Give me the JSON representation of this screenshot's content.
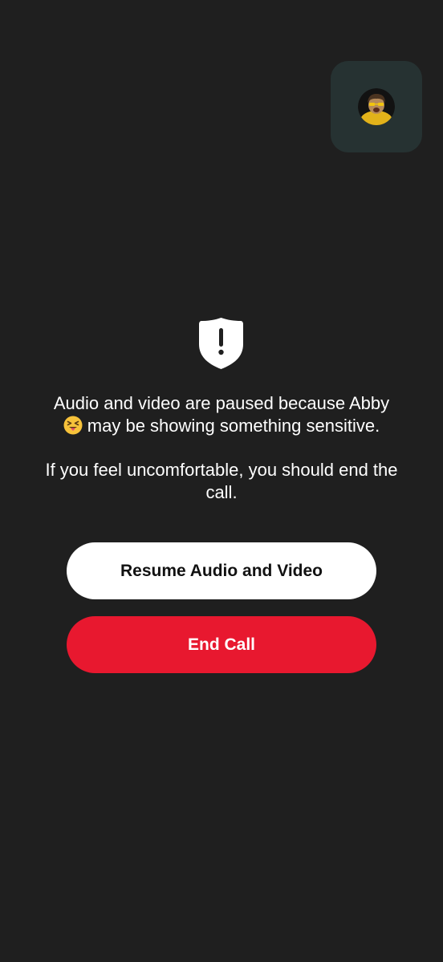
{
  "self_view": {
    "avatar_icon": "user-avatar-icon"
  },
  "warning": {
    "icon": "shield-exclamation-icon",
    "line1_text": "Audio and video are paused because Abby",
    "emoji": "squinting-tongue-emoji",
    "line1_rest": "may be showing something sensitive.",
    "line2_text": "If you feel uncomfortable, you should end the call."
  },
  "actions": {
    "resume_label": "Resume Audio and Video",
    "end_label": "End Call"
  },
  "colors": {
    "background": "#1f1f1f",
    "self_view_tile": "#263232",
    "end_call": "#e8182f",
    "resume": "#ffffff"
  }
}
